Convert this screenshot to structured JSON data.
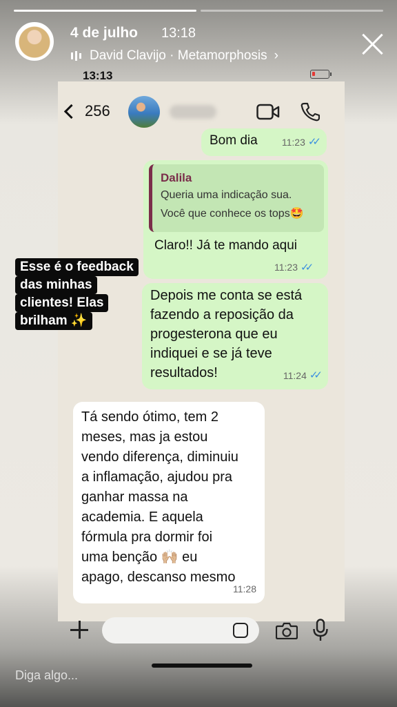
{
  "story": {
    "date": "4 de julho",
    "time": "13:18",
    "author": "David Clavijo · Metamorphosis",
    "author_chevron": "›",
    "reply_placeholder": "Diga algo..."
  },
  "phone": {
    "status_time": "13:13"
  },
  "chat_header": {
    "back_count": "256"
  },
  "messages": [
    {
      "text": "Bom dia",
      "time": "11:23",
      "ticks": "✓✓"
    },
    {
      "quote_name": "Dalila",
      "quote_text": [
        "Queria uma indicação sua.",
        "Você que conhece os tops"
      ],
      "quote_emoji": "🤩",
      "text": "Claro!! Já te mando aqui",
      "time": "11:23",
      "ticks": "✓✓"
    },
    {
      "lines": [
        "Depois me conta se está",
        "fazendo a reposição da",
        "progesterona que eu",
        "indiquei e se já teve",
        "resultados!"
      ],
      "time": "11:24",
      "ticks": "✓✓"
    },
    {
      "lines": [
        "Tá sendo ótimo, tem 2",
        "meses, mas ja estou",
        "vendo diferença, diminuiu",
        "a inflamação, ajudou pra",
        "ganhar massa na",
        "academia. E aquela",
        "fórmula pra dormir foi",
        "uma benção",
        "apago, descanso mesmo"
      ],
      "line8_emoji": "🙌🏼",
      "line8_tail": "eu",
      "time": "11:28"
    }
  ],
  "overlay_text": {
    "lines": [
      "Esse é o feedback",
      "das minhas",
      "clientes! Elas",
      "brilham"
    ],
    "emoji": "✨"
  },
  "icons": {
    "back": "chevron-left-icon",
    "video": "video-camera-icon",
    "phone": "phone-icon",
    "add": "plus-icon",
    "sticker": "sticker-icon",
    "camera": "camera-icon",
    "mic": "microphone-icon",
    "close": "close-icon",
    "music": "music-bars-icon"
  },
  "colors": {
    "outgoing_bubble": "#d5f6c6",
    "incoming_bubble": "#ffffff",
    "read_ticks": "#3b8fe0",
    "quote_accent": "#7a2d4a",
    "chat_bg": "#ebe6dc"
  }
}
